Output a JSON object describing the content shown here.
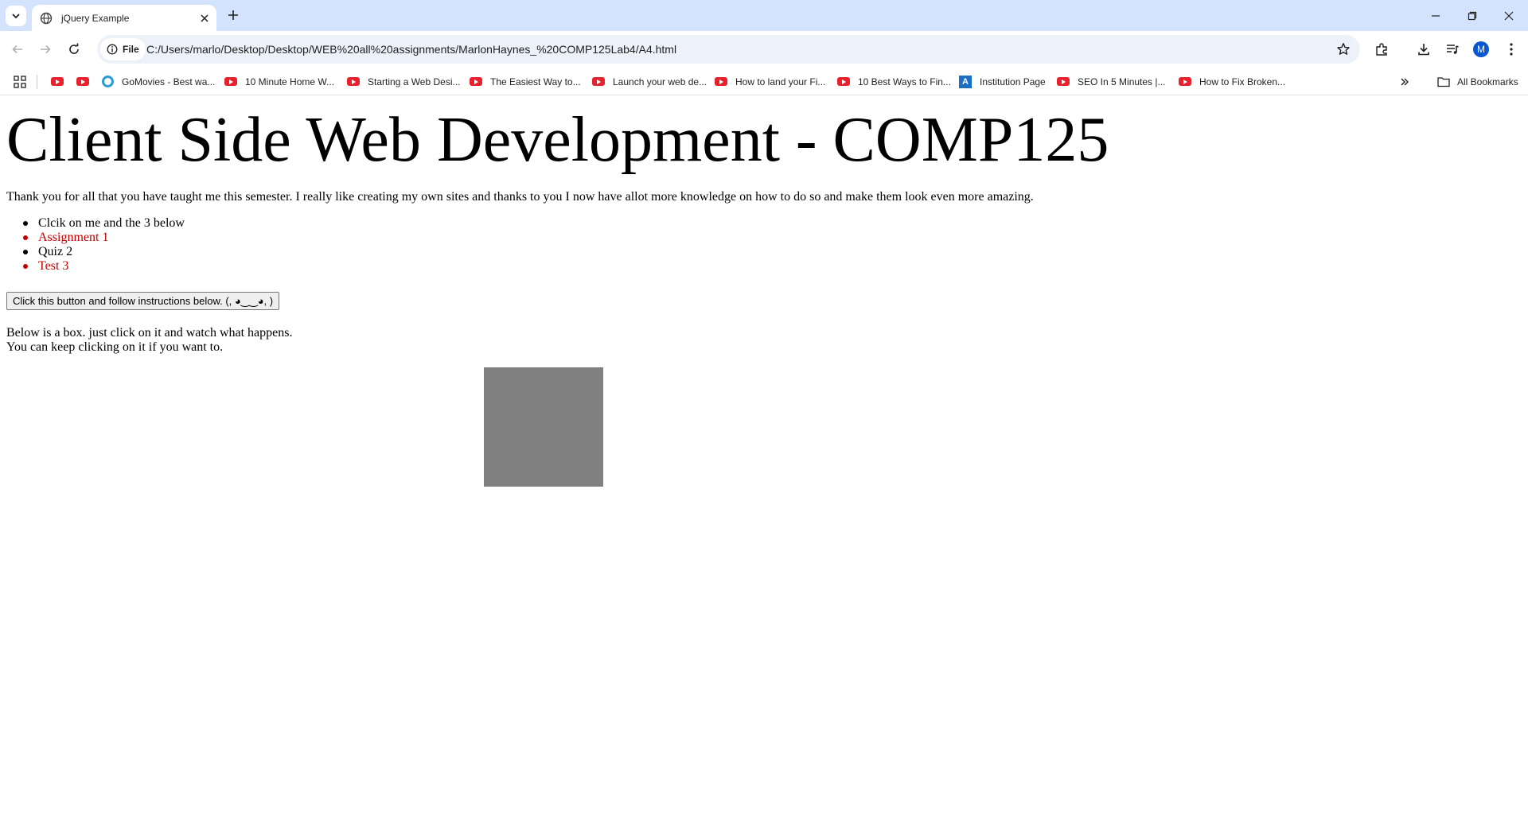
{
  "browser": {
    "tab_title": "jQuery Example",
    "address_chip": "File",
    "url": "C:/Users/marlo/Desktop/Desktop/WEB%20all%20assignments/MarlonHaynes_%20COMP125Lab4/A4.html",
    "avatar_initial": "M",
    "bookmarks": [
      {
        "label": "",
        "icon": "youtube-icon"
      },
      {
        "label": "",
        "icon": "youtube-icon"
      },
      {
        "label": "GoMovies - Best wa...",
        "icon": "gomovies-icon"
      },
      {
        "label": "10 Minute Home W...",
        "icon": "youtube-icon"
      },
      {
        "label": "Starting a Web Desi...",
        "icon": "youtube-icon"
      },
      {
        "label": "The Easiest Way to...",
        "icon": "youtube-icon"
      },
      {
        "label": "Launch your web de...",
        "icon": "youtube-icon"
      },
      {
        "label": "How to land your Fi...",
        "icon": "youtube-icon"
      },
      {
        "label": "10 Best Ways to Fin...",
        "icon": "youtube-icon"
      },
      {
        "label": "Institution Page",
        "icon": "institution-icon"
      },
      {
        "label": "SEO In 5 Minutes |...",
        "icon": "youtube-icon"
      },
      {
        "label": "How to Fix Broken...",
        "icon": "youtube-icon"
      }
    ],
    "all_bookmarks": "All Bookmarks"
  },
  "page": {
    "heading": "Client Side Web Development - COMP125",
    "intro": "Thank you for all that you have taught me this semester. I really like creating my own sites and thanks to you I now have allot more knowledge on how to do so and make them look even more amazing.",
    "list": [
      {
        "text": "Clcik on me and the 3 below",
        "color": "#000000"
      },
      {
        "text": "Assignment 1",
        "color": "#c00000"
      },
      {
        "text": "Quiz 2",
        "color": "#000000"
      },
      {
        "text": "Test 3",
        "color": "#c00000"
      }
    ],
    "button_label": "Click this button and follow instructions below. (, ◕‿‿◕, )",
    "note_line1": "Below is a box. just click on it and watch what happens.",
    "note_line2": "You can keep clicking on it if you want to.",
    "box_color": "#808080"
  }
}
